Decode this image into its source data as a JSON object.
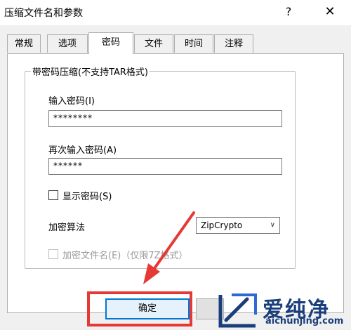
{
  "window": {
    "title": "压缩文件名和参数",
    "help_label": "?",
    "close_label": "✕"
  },
  "tabs": [
    {
      "label": "常规",
      "active": false
    },
    {
      "label": "选项",
      "active": false
    },
    {
      "label": "密码",
      "active": true
    },
    {
      "label": "文件",
      "active": false
    },
    {
      "label": "时间",
      "active": false
    },
    {
      "label": "注释",
      "active": false
    }
  ],
  "password_group": {
    "legend": "带密码压缩(不支持TAR格式)",
    "enter_label": "输入密码(I)",
    "enter_value": "********",
    "reenter_label": "再次输入密码(A)",
    "reenter_value": "******",
    "show_password_label": "显示密码(S)",
    "show_password_checked": false,
    "encryption_label": "加密算法",
    "encryption_value": "ZipCrypto",
    "encrypt_filenames_label": "加密文件名(E)（仅限7Z格式）",
    "encrypt_filenames_checked": false
  },
  "buttons": {
    "ok_label": "确定"
  },
  "watermark": {
    "brand": "爱纯净",
    "url": "aichunjing.com"
  },
  "colors": {
    "accent": "#0078d7",
    "highlight": "#e53935",
    "watermark": "#1a3e7a"
  }
}
